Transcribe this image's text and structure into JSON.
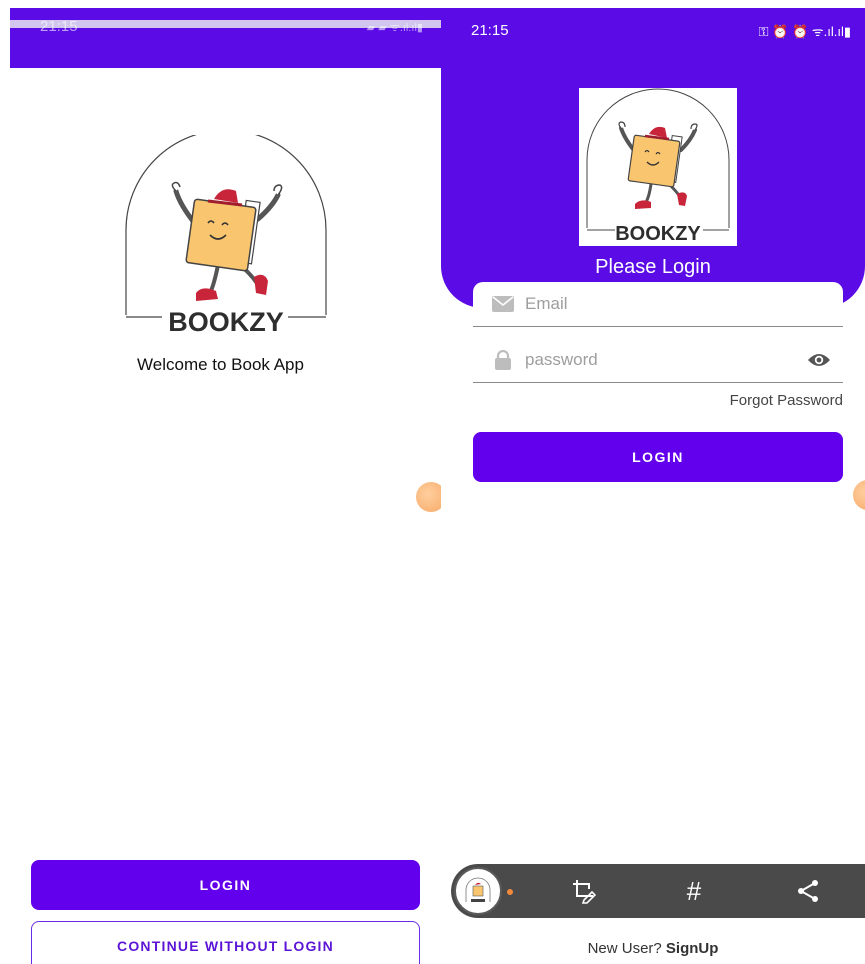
{
  "left_screen": {
    "status": {
      "time": "21:15"
    },
    "brand": "BOOKZY",
    "welcome_text": "Welcome to Book App",
    "login_label": "LOGIN",
    "continue_label": "CONTINUE WITHOUT LOGIN"
  },
  "right_screen": {
    "status": {
      "time": "21:15",
      "icons": "⚿ ⏰ ⏰ ᯤ.ıl.ıl▮"
    },
    "brand": "BOOKZY",
    "title": "Please Login",
    "email": {
      "placeholder": "Email"
    },
    "password": {
      "placeholder": "password"
    },
    "forgot_label": "Forgot Password",
    "login_label": "LOGIN",
    "toolbar": {
      "tools": [
        "crop-edit-icon",
        "hashtag-icon",
        "share-icon"
      ],
      "hash_symbol": "#"
    },
    "signup": {
      "prefix": "New User? ",
      "link": "SignUp"
    }
  },
  "colors": {
    "primary": "#6200ee",
    "header": "#5a0be6",
    "book": "#f9c56e",
    "shoe": "#c8253a",
    "float_dot": "#f7a867"
  }
}
